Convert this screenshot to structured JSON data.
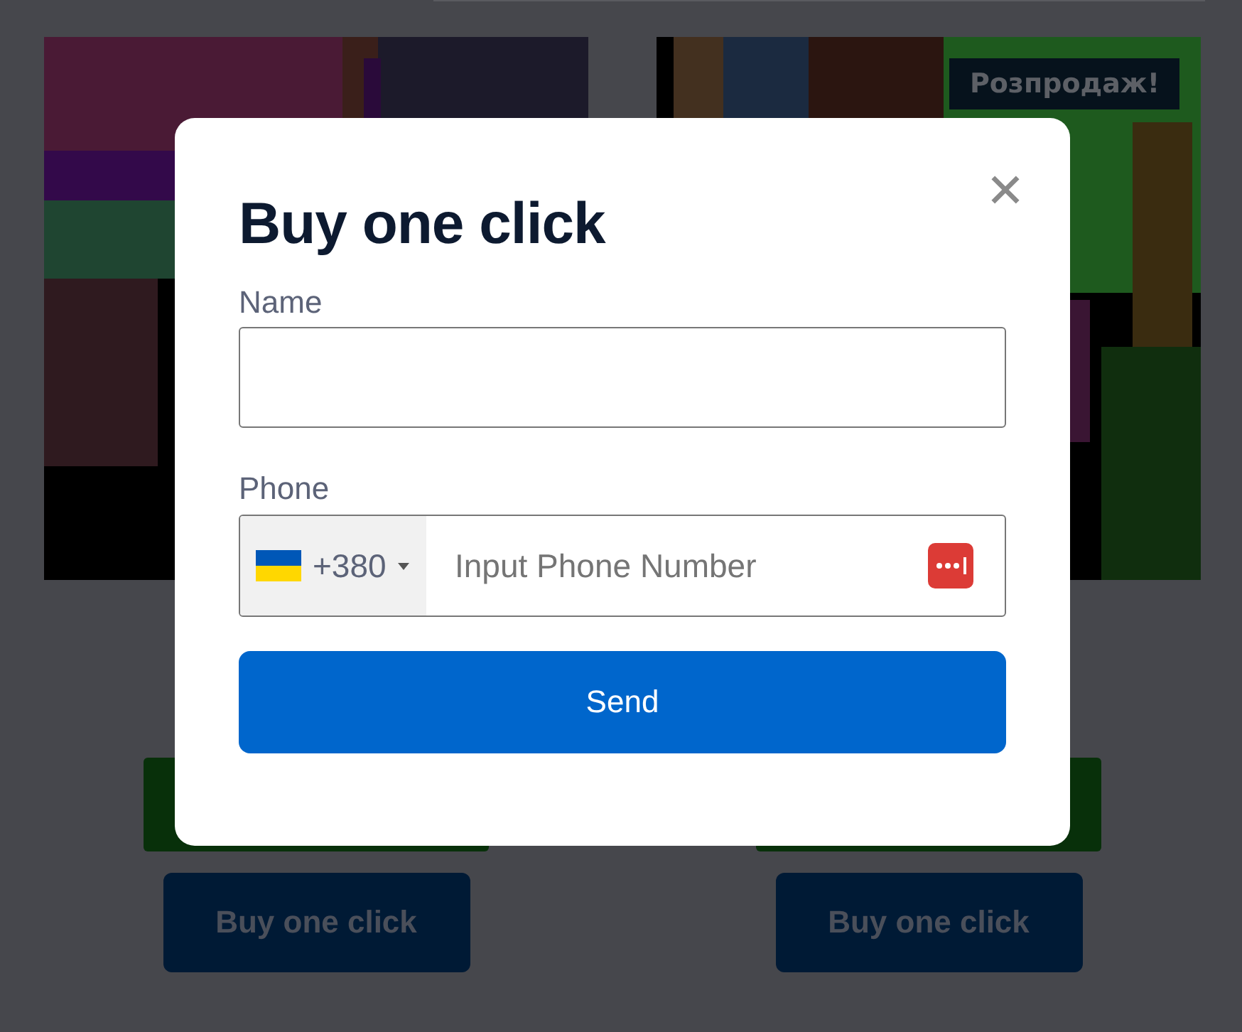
{
  "products": [
    {
      "buy_button": "Buy one click"
    },
    {
      "badge": "Розпродаж!",
      "buy_button": "Buy one click"
    }
  ],
  "modal": {
    "title": "Buy one click",
    "fields": [
      {
        "kind": "text",
        "label": "Name"
      },
      {
        "kind": "phone",
        "label": "Phone",
        "country_code": "+380",
        "placeholder": "Input Phone Number"
      }
    ],
    "submit": "Send"
  }
}
